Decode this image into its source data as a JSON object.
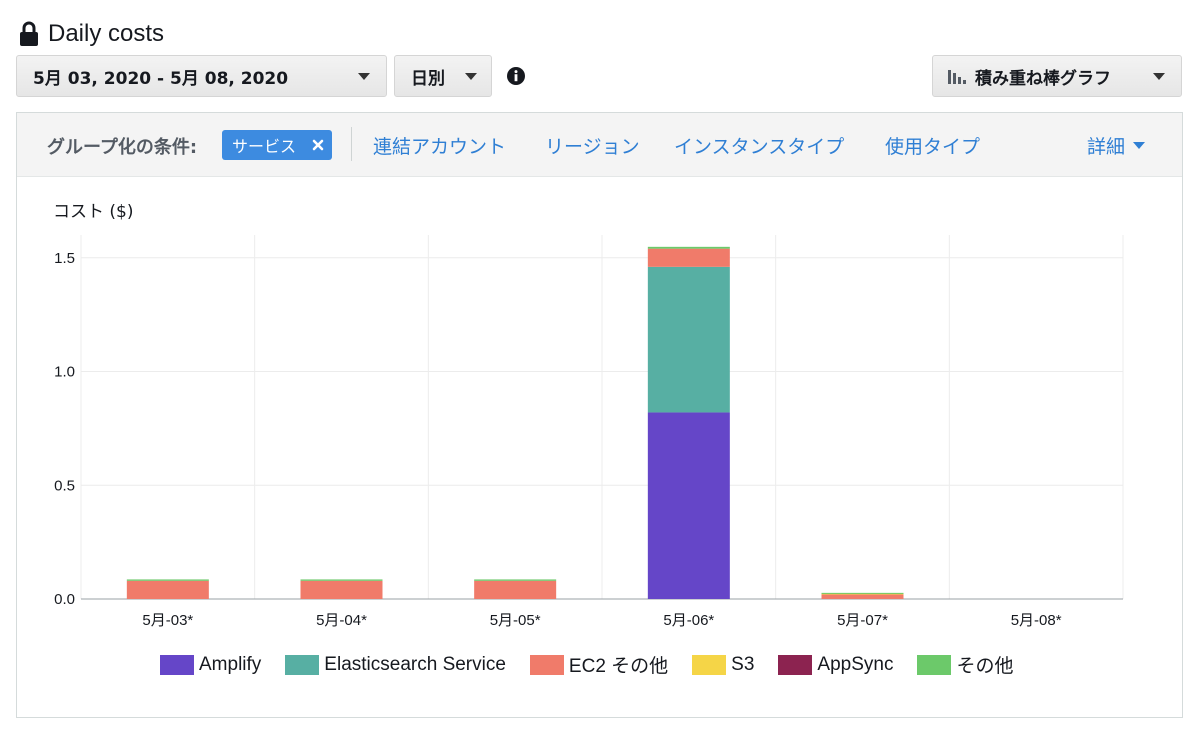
{
  "header": {
    "title": "Daily costs",
    "lock_icon": "lock-icon"
  },
  "controls": {
    "date_range": "5月 03, 2020 - 5月 08, 2020",
    "granularity": "日別",
    "info_icon": "info-icon",
    "chart_type": "積み重ね棒グラフ",
    "chart_type_icon": "bar-chart-icon"
  },
  "group_by": {
    "label": "グループ化の条件:",
    "active_chip": "サービス",
    "options": [
      "連結アカウント",
      "リージョン",
      "インスタンスタイプ",
      "使用タイプ"
    ],
    "more_label": "詳細"
  },
  "colors": {
    "accent": "#3d8be0",
    "link": "#2f7fd4",
    "Amplify": "#6546c8",
    "Elasticsearch Service": "#57afa3",
    "EC2 その他": "#f07b6a",
    "S3": "#f5d547",
    "AppSync": "#8c2350",
    "その他": "#6cc96a"
  },
  "chart_data": {
    "type": "bar",
    "stacked": true,
    "ylabel": "コスト ($)",
    "ylim": [
      0,
      1.6
    ],
    "yticks": [
      0.0,
      0.5,
      1.0,
      1.5
    ],
    "ytick_labels": [
      "0.0",
      "0.5",
      "1.0",
      "1.5"
    ],
    "categories": [
      "5月-03*",
      "5月-04*",
      "5月-05*",
      "5月-06*",
      "5月-07*",
      "5月-08*"
    ],
    "grid": true,
    "legend_position": "bottom",
    "series": [
      {
        "name": "Amplify",
        "values": [
          0,
          0,
          0,
          0.82,
          0,
          0
        ]
      },
      {
        "name": "Elasticsearch Service",
        "values": [
          0,
          0,
          0,
          0.64,
          0,
          0
        ]
      },
      {
        "name": "EC2 その他",
        "values": [
          0.08,
          0.08,
          0.08,
          0.08,
          0.02,
          0
        ]
      },
      {
        "name": "S3",
        "values": [
          0,
          0,
          0,
          0,
          0.005,
          0
        ]
      },
      {
        "name": "AppSync",
        "values": [
          0,
          0,
          0,
          0,
          0,
          0
        ]
      },
      {
        "name": "その他",
        "values": [
          0.006,
          0.006,
          0.006,
          0.008,
          0.002,
          0
        ]
      }
    ]
  }
}
